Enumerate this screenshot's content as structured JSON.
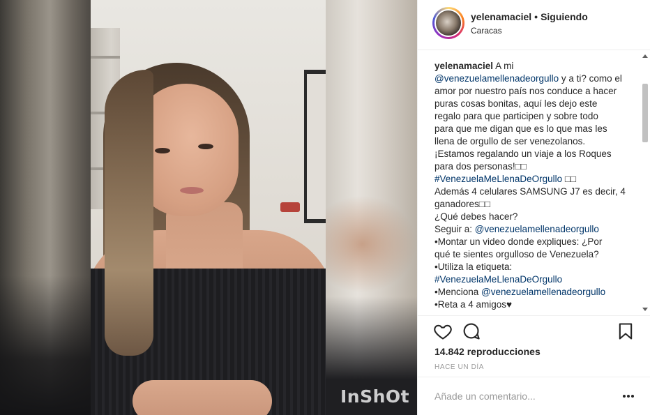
{
  "post": {
    "username": "yelenamaciel",
    "separator": "•",
    "follow_status": "Siguiendo",
    "location": "Caracas",
    "watermark": "InShOt",
    "caption_lines": [
      [
        {
          "t": "yelenamaciel",
          "k": "user"
        },
        {
          "t": " A mi",
          "k": "text"
        }
      ],
      [
        {
          "t": "@venezuelamellenadeorgullo",
          "k": "link"
        },
        {
          "t": " y a ti? como el",
          "k": "text"
        }
      ],
      [
        {
          "t": "amor por nuestro país nos conduce a hacer",
          "k": "text"
        }
      ],
      [
        {
          "t": "puras cosas bonitas, aquí les dejo este",
          "k": "text"
        }
      ],
      [
        {
          "t": "regalo para que participen y sobre todo",
          "k": "text"
        }
      ],
      [
        {
          "t": "para que me digan que es lo que mas les",
          "k": "text"
        }
      ],
      [
        {
          "t": "llena de orgullo de ser venezolanos.",
          "k": "text"
        }
      ],
      [
        {
          "t": "¡Estamos regalando un viaje a los Roques",
          "k": "text"
        }
      ],
      [
        {
          "t": "para dos personas!□□",
          "k": "text"
        }
      ],
      [
        {
          "t": "#VenezuelaMeLlenaDeOrgullo",
          "k": "link"
        },
        {
          "t": " □□",
          "k": "text"
        }
      ],
      [
        {
          "t": "Además 4 celulares SAMSUNG J7 es decir, 4",
          "k": "text"
        }
      ],
      [
        {
          "t": "ganadores□□",
          "k": "text"
        }
      ],
      [
        {
          "t": "¿Qué debes hacer?",
          "k": "text"
        }
      ],
      [
        {
          "t": "Seguir a: ",
          "k": "text"
        },
        {
          "t": "@venezuelamellenadeorgullo",
          "k": "link"
        }
      ],
      [
        {
          "t": "•Montar un video donde expliques: ¿Por",
          "k": "text"
        }
      ],
      [
        {
          "t": "qué te sientes orgulloso de Venezuela?",
          "k": "text"
        }
      ],
      [
        {
          "t": "•Utiliza la etiqueta:",
          "k": "text"
        }
      ],
      [
        {
          "t": "#VenezuelaMeLlenaDeOrgullo",
          "k": "link"
        }
      ],
      [
        {
          "t": "•Menciona ",
          "k": "text"
        },
        {
          "t": "@venezuelamellenadeorgullo",
          "k": "link"
        }
      ],
      [
        {
          "t": "•Reta a 4 amigos♥",
          "k": "text"
        }
      ]
    ],
    "views": "14.842 reproducciones",
    "time_ago": "HACE UN DÍA",
    "comment_placeholder": "Añade un comentario...",
    "icons": {
      "like": "heart-outline-icon",
      "comment": "speech-bubble-icon",
      "save": "bookmark-icon",
      "more": "more-options-icon"
    },
    "colors": {
      "link": "#003569",
      "text": "#262626",
      "muted": "#999999",
      "divider": "#efefef"
    }
  }
}
